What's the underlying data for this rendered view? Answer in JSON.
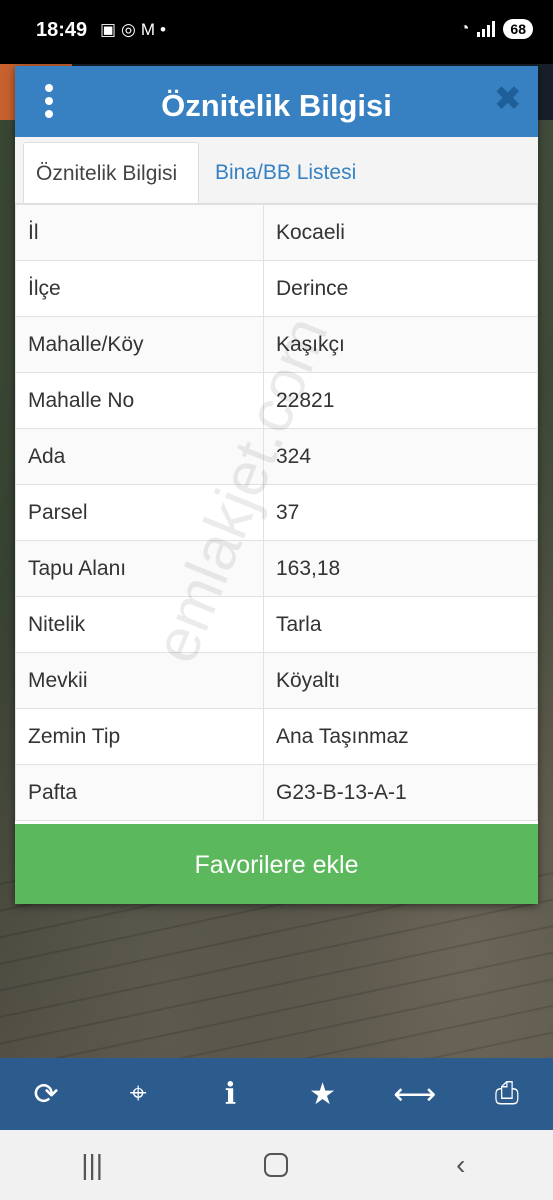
{
  "status_bar": {
    "time": "18:49",
    "battery": "68"
  },
  "modal": {
    "title": "Öznitelik Bilgisi",
    "tabs": [
      {
        "label": "Öznitelik Bilgisi",
        "active": true
      },
      {
        "label": "Bina/BB Listesi",
        "active": false
      }
    ],
    "rows": [
      {
        "key": "İl",
        "value": "Kocaeli"
      },
      {
        "key": "İlçe",
        "value": "Derince"
      },
      {
        "key": "Mahalle/Köy",
        "value": "Kaşıkçı"
      },
      {
        "key": "Mahalle No",
        "value": "22821"
      },
      {
        "key": "Ada",
        "value": "324"
      },
      {
        "key": "Parsel",
        "value": "37"
      },
      {
        "key": "Tapu Alanı",
        "value": "163,18"
      },
      {
        "key": "Nitelik",
        "value": "Tarla"
      },
      {
        "key": "Mevkii",
        "value": "Köyaltı"
      },
      {
        "key": "Zemin Tip",
        "value": "Ana Taşınmaz"
      },
      {
        "key": "Pafta",
        "value": "G23-B-13-A-1"
      }
    ],
    "button_label": "Favorilere ekle"
  },
  "watermark": "emlakjet.com",
  "toolbar": {
    "icons": [
      "refresh-icon",
      "locate-icon",
      "info-icon",
      "star-icon",
      "measure-icon",
      "print-icon"
    ]
  },
  "colors": {
    "header": "#3781c2",
    "button": "#5cb85c",
    "toolbar": "#2c5b8e"
  }
}
